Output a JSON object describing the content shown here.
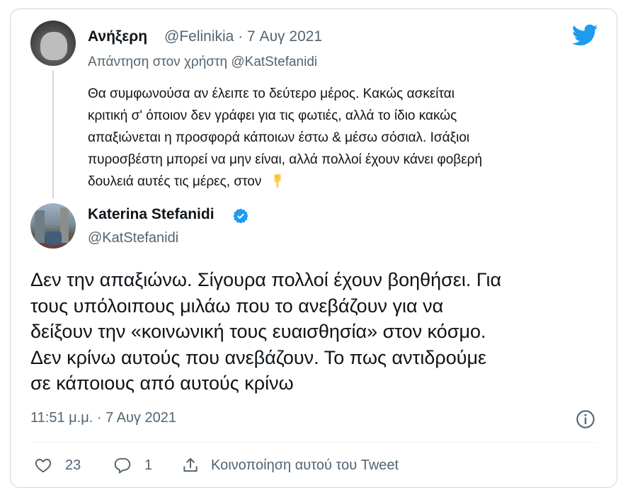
{
  "reply": {
    "author_name": "Ανήξερη",
    "handle": "@Felinikia",
    "separator": "·",
    "date": "7 Αυγ 2021",
    "replying_to": "Απάντηση στον χρήστη @KatStefanidi",
    "text_lines": [
      "Θα συμφωνούσα αν έλειπε το δεύτερο μέρος. Κακώς ασκείται",
      "κριτική σ' όποιον δεν γράφει για τις φωτιές, αλλά το ίδιο κακώς",
      "απαξιώνεται η προσφορά κάποιων έστω & μέσω σόσιαλ. Ισάξιοι",
      "πυροσβέστη μπορεί να μην είναι, αλλά πολλοί έχουν κάνει φοβερή",
      "δουλειά αυτές τις μέρες, στον"
    ],
    "emoji": "hand-pointing-down-icon"
  },
  "tweet": {
    "author_name": "Katerina Stefanidi",
    "handle": "@KatStefanidi",
    "text_lines": [
      "Δεν την απαξιώνω. Σίγουρα πολλοί έχουν βοηθήσει. Για",
      "τους υπόλοιπους μιλάω που το ανεβάζουν για να",
      "δείξουν την «κοινωνική τους ευαισθησία» στον κόσμο.",
      "Δεν κρίνω αυτούς που ανεβάζουν. Το πως αντιδρούμε",
      "σε κάποιους από αυτούς κρίνω"
    ],
    "time": "11:51 μ.μ.",
    "separator": "·",
    "date": "7 Αυγ 2021",
    "likes": "23",
    "replies": "1",
    "share_label": "Κοινοποίηση αυτού του Tweet"
  },
  "colors": {
    "text": "#0f1419",
    "secondary": "#536471",
    "twitter_blue": "#1d9bf0",
    "border": "#cfd9de"
  }
}
